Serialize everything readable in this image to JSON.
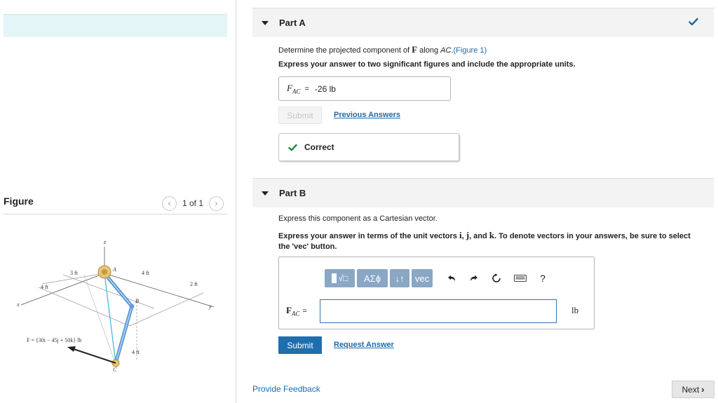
{
  "figure": {
    "title": "Figure",
    "nav_count": "1 of 1",
    "prev_icon": "chevron-left-icon",
    "next_icon": "chevron-right-icon",
    "labels": {
      "z": "z",
      "x": "x",
      "y": "y",
      "A": "A",
      "B": "B",
      "C": "C",
      "dim_3ft": "3 ft",
      "dim_4ft_left": "4 ft",
      "dim_4ft_top": "4 ft",
      "dim_2ft": "2 ft",
      "dim_4ft_vert": "4 ft",
      "force": "F = {30i − 45j + 50k} lb"
    }
  },
  "part_a": {
    "label": "Part A",
    "status_icon": "check-icon",
    "q_prefix": "Determine the projected component of ",
    "q_F": "F",
    "q_mid": " along ",
    "q_AC": "AC",
    "q_dot": ".",
    "q_link": "(Figure 1)",
    "instruction": "Express your answer to two significant figures and include the appropriate units.",
    "answer_var": "F",
    "answer_sub": "AC",
    "answer_eq": "=",
    "answer_value": "-26 lb",
    "submit_label": "Submit",
    "prev_answers_label": "Previous Answers",
    "correct_label": "Correct"
  },
  "part_b": {
    "label": "Part B",
    "question": "Express this component as a Cartesian vector.",
    "instr_1": "Express your answer in terms of the unit vectors ",
    "instr_i": "i",
    "instr_sep1": ", ",
    "instr_j": "j",
    "instr_and": ", and ",
    "instr_k": "k",
    "instr_2": ". To denote vectors in your answers, be sure to select the 'vec' button.",
    "toolbar": {
      "templates": "√□",
      "greek": "AΣϕ",
      "arrows": "↓↑",
      "vec": "vec",
      "help": "?"
    },
    "input_label": "F",
    "input_sub": "AC",
    "input_eq": "=",
    "input_value": "",
    "unit": "lb",
    "submit_label": "Submit",
    "request_label": "Request Answer"
  },
  "footer": {
    "feedback": "Provide Feedback",
    "next": "Next"
  },
  "colors": {
    "accent_blue": "#1d6fae",
    "link_blue": "#1a6cb0",
    "check_green": "#1a8a3c",
    "toolbar_blue": "#8aa7c4",
    "banner": "#e3f5f7"
  }
}
